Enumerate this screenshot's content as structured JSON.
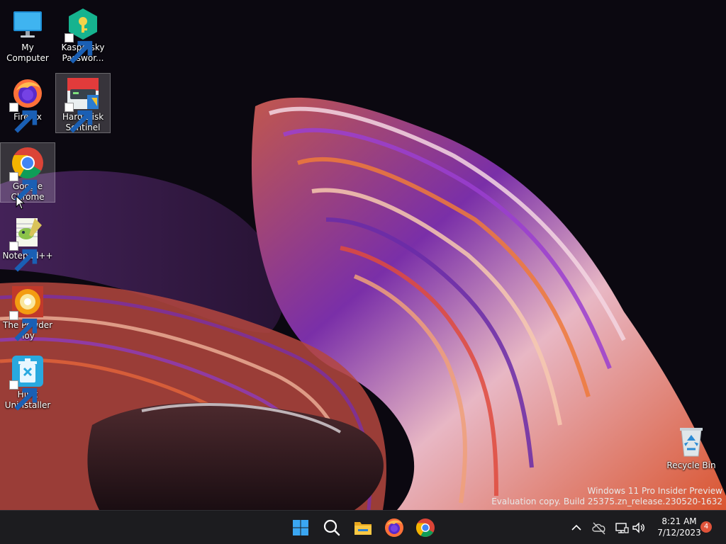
{
  "desktop_icons": [
    {
      "label": "My Computer",
      "icon": "monitor-icon"
    },
    {
      "label": "Kaspersky Passwor...",
      "icon": "kaspersky-password-icon"
    },
    {
      "label": "Firefox",
      "icon": "firefox-icon"
    },
    {
      "label": "Hard Disk Sentinel",
      "icon": "hard-disk-sentinel-icon"
    },
    {
      "label": "Google Chrome",
      "icon": "chrome-icon"
    },
    {
      "label": "Notepad++",
      "icon": "notepad-plus-plus-icon"
    },
    {
      "label": "The Powder Toy",
      "icon": "powder-toy-icon"
    },
    {
      "label": "HiBit Uninstaller",
      "icon": "hibit-uninstaller-icon"
    },
    {
      "label": "Recycle Bin",
      "icon": "recycle-bin-icon"
    }
  ],
  "watermark": {
    "line1": "Windows 11 Pro Insider Preview",
    "line2": "Evaluation copy. Build 25375.zn_release.230520-1632"
  },
  "taskbar": {
    "apps": [
      "start-icon",
      "search-icon",
      "file-explorer-icon",
      "firefox-icon",
      "chrome-icon"
    ],
    "clock": {
      "time": "8:21 AM",
      "date": "7/12/2023"
    },
    "notification_count": "4"
  },
  "colors": {
    "taskbar": "#1c1c1f",
    "accent": "#0078d4",
    "notification": "#e0533a"
  }
}
